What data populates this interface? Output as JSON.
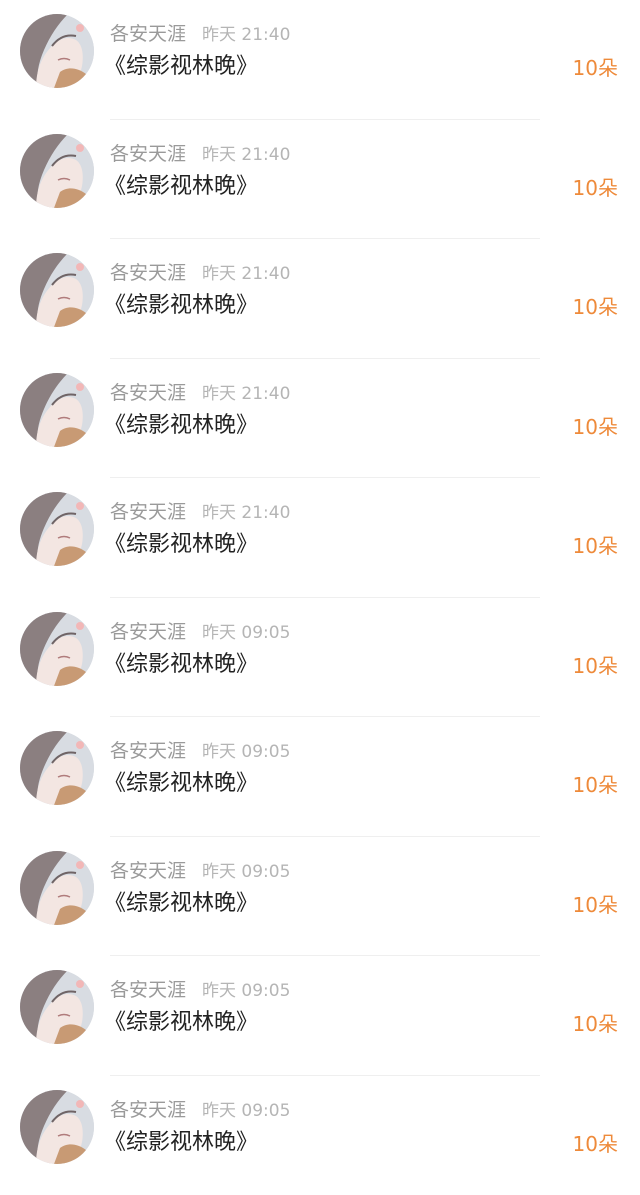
{
  "list": {
    "items": [
      {
        "username": "各安天涯",
        "time": "昨天 21:40",
        "title": "《综影视林晚》",
        "gift": "10朵"
      },
      {
        "username": "各安天涯",
        "time": "昨天 21:40",
        "title": "《综影视林晚》",
        "gift": "10朵"
      },
      {
        "username": "各安天涯",
        "time": "昨天 21:40",
        "title": "《综影视林晚》",
        "gift": "10朵"
      },
      {
        "username": "各安天涯",
        "time": "昨天 21:40",
        "title": "《综影视林晚》",
        "gift": "10朵"
      },
      {
        "username": "各安天涯",
        "time": "昨天 21:40",
        "title": "《综影视林晚》",
        "gift": "10朵"
      },
      {
        "username": "各安天涯",
        "time": "昨天 09:05",
        "title": "《综影视林晚》",
        "gift": "10朵"
      },
      {
        "username": "各安天涯",
        "time": "昨天 09:05",
        "title": "《综影视林晚》",
        "gift": "10朵"
      },
      {
        "username": "各安天涯",
        "time": "昨天 09:05",
        "title": "《综影视林晚》",
        "gift": "10朵"
      },
      {
        "username": "各安天涯",
        "time": "昨天 09:05",
        "title": "《综影视林晚》",
        "gift": "10朵"
      },
      {
        "username": "各安天涯",
        "time": "昨天 09:05",
        "title": "《综影视林晚》",
        "gift": "10朵"
      }
    ]
  },
  "colors": {
    "username": "#9a9a9a",
    "time": "#b5b5b5",
    "title": "#222222",
    "gift": "#ee8a3a",
    "divider": "#efefef"
  },
  "avatar_icon": "illustrated-user-avatar-icon"
}
